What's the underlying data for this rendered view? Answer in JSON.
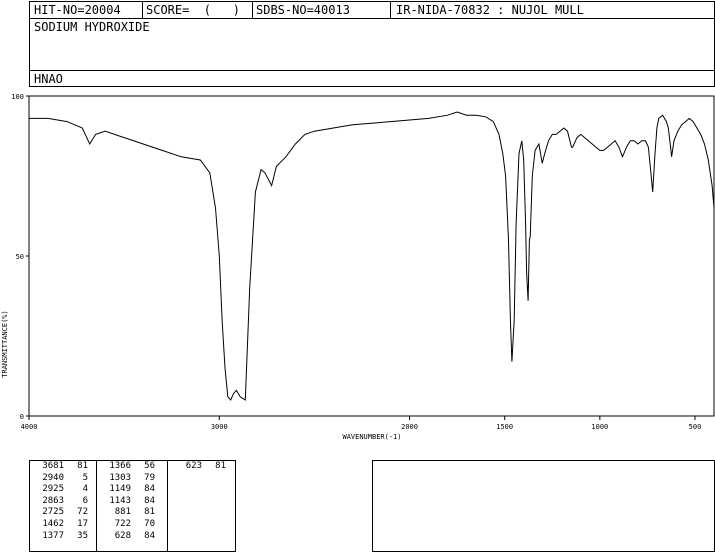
{
  "header": {
    "hit_no": "HIT-NO=20004",
    "score": "SCORE=  (   )",
    "sdbs_no": "SDBS-NO=40013",
    "ir_nida": "IR-NIDA-70832 : NUJOL MULL",
    "compound_name": "SODIUM HYDROXIDE",
    "formula": "HNAO"
  },
  "chart_data": {
    "type": "line",
    "title": "",
    "xlabel": "WAVENUMBER(-1)",
    "ylabel": "TRANSMITTANCE(%)",
    "xlim": [
      4000,
      400
    ],
    "ylim": [
      0,
      100
    ],
    "x_ticks": [
      4000,
      3000,
      2000,
      1500,
      1000,
      500
    ],
    "y_ticks": [
      0,
      50,
      100
    ],
    "grid": false,
    "series": [
      {
        "name": "",
        "color": "#000000",
        "points": [
          [
            4000,
            93
          ],
          [
            3900,
            93
          ],
          [
            3800,
            92
          ],
          [
            3720,
            90
          ],
          [
            3681,
            85
          ],
          [
            3650,
            88
          ],
          [
            3600,
            89
          ],
          [
            3500,
            87
          ],
          [
            3400,
            85
          ],
          [
            3300,
            83
          ],
          [
            3200,
            81
          ],
          [
            3100,
            80
          ],
          [
            3050,
            76
          ],
          [
            3020,
            65
          ],
          [
            3000,
            50
          ],
          [
            2985,
            30
          ],
          [
            2970,
            15
          ],
          [
            2955,
            6
          ],
          [
            2940,
            5
          ],
          [
            2925,
            7
          ],
          [
            2910,
            8
          ],
          [
            2890,
            6
          ],
          [
            2863,
            5
          ],
          [
            2840,
            40
          ],
          [
            2810,
            70
          ],
          [
            2780,
            77
          ],
          [
            2760,
            76
          ],
          [
            2725,
            72
          ],
          [
            2700,
            78
          ],
          [
            2650,
            81
          ],
          [
            2600,
            85
          ],
          [
            2550,
            88
          ],
          [
            2500,
            89
          ],
          [
            2400,
            90
          ],
          [
            2300,
            91
          ],
          [
            2200,
            91.5
          ],
          [
            2100,
            92
          ],
          [
            2000,
            92.5
          ],
          [
            1900,
            93
          ],
          [
            1800,
            94
          ],
          [
            1750,
            95
          ],
          [
            1700,
            94
          ],
          [
            1650,
            94
          ],
          [
            1600,
            93.5
          ],
          [
            1560,
            92
          ],
          [
            1530,
            88
          ],
          [
            1510,
            82
          ],
          [
            1495,
            75
          ],
          [
            1480,
            55
          ],
          [
            1470,
            30
          ],
          [
            1462,
            17
          ],
          [
            1450,
            30
          ],
          [
            1440,
            60
          ],
          [
            1425,
            82
          ],
          [
            1410,
            86
          ],
          [
            1400,
            80
          ],
          [
            1390,
            60
          ],
          [
            1385,
            45
          ],
          [
            1377,
            36
          ],
          [
            1370,
            55
          ],
          [
            1366,
            56
          ],
          [
            1355,
            75
          ],
          [
            1340,
            83
          ],
          [
            1320,
            85
          ],
          [
            1303,
            79
          ],
          [
            1290,
            82
          ],
          [
            1270,
            86
          ],
          [
            1250,
            88
          ],
          [
            1230,
            88
          ],
          [
            1210,
            89
          ],
          [
            1190,
            90
          ],
          [
            1170,
            89
          ],
          [
            1149,
            84
          ],
          [
            1143,
            84
          ],
          [
            1120,
            87
          ],
          [
            1100,
            88
          ],
          [
            1080,
            87
          ],
          [
            1060,
            86
          ],
          [
            1040,
            85
          ],
          [
            1020,
            84
          ],
          [
            1000,
            83
          ],
          [
            980,
            83
          ],
          [
            960,
            84
          ],
          [
            940,
            85
          ],
          [
            920,
            86
          ],
          [
            900,
            84
          ],
          [
            881,
            81
          ],
          [
            860,
            84
          ],
          [
            840,
            86
          ],
          [
            820,
            86
          ],
          [
            800,
            85
          ],
          [
            780,
            86
          ],
          [
            760,
            86
          ],
          [
            745,
            84
          ],
          [
            722,
            70
          ],
          [
            710,
            82
          ],
          [
            700,
            90
          ],
          [
            690,
            93
          ],
          [
            670,
            94
          ],
          [
            650,
            92
          ],
          [
            640,
            90
          ],
          [
            628,
            84
          ],
          [
            623,
            81
          ],
          [
            610,
            86
          ],
          [
            590,
            89
          ],
          [
            570,
            91
          ],
          [
            550,
            92
          ],
          [
            530,
            93
          ],
          [
            510,
            92
          ],
          [
            490,
            90
          ],
          [
            470,
            88
          ],
          [
            450,
            85
          ],
          [
            430,
            80
          ],
          [
            410,
            72
          ],
          [
            400,
            65
          ]
        ]
      }
    ],
    "peak_table": [
      [
        [
          3681,
          81
        ],
        [
          2940,
          5
        ],
        [
          2925,
          4
        ],
        [
          2863,
          6
        ],
        [
          2725,
          72
        ],
        [
          1462,
          17
        ],
        [
          1377,
          35
        ]
      ],
      [
        [
          1366,
          56
        ],
        [
          1303,
          79
        ],
        [
          1149,
          84
        ],
        [
          1143,
          84
        ],
        [
          881,
          81
        ],
        [
          722,
          70
        ],
        [
          628,
          84
        ]
      ],
      [
        [
          623,
          81
        ]
      ]
    ]
  }
}
